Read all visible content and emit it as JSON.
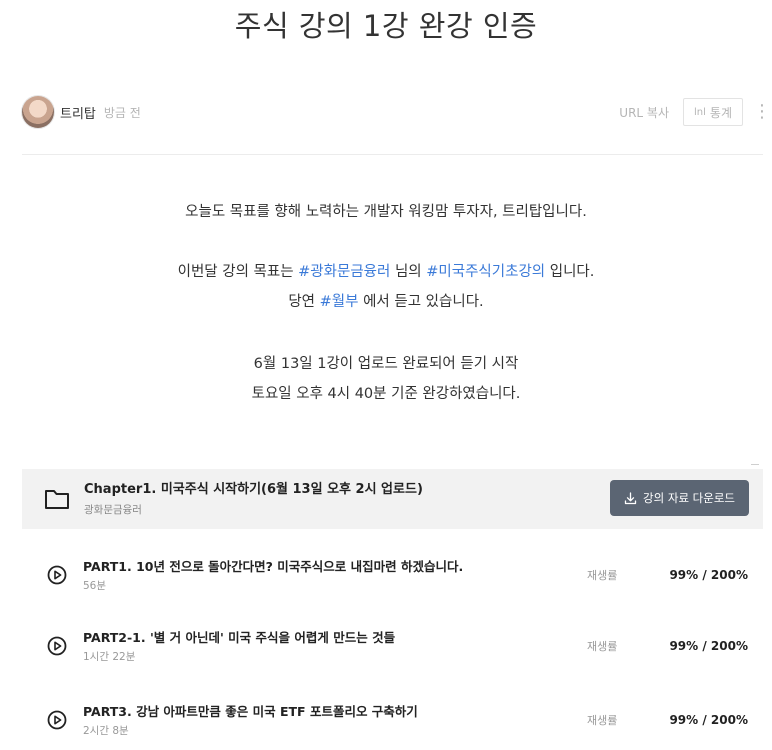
{
  "post": {
    "title": "주식 강의 1강 완강 인증",
    "author": "트리탑",
    "time": "방금 전",
    "url_copy": "URL 복사",
    "stats_label": "통계",
    "stats_icon": "lnl",
    "more_icon": "⋮"
  },
  "body": {
    "line1": "오늘도 목표를 향해 노력하는 개발자 워킹맘 투자자, 트리탑입니다.",
    "line2_pre": "이번달 강의 목표는 ",
    "line2_tag1": "#광화문금융러",
    "line2_mid": " 님의 ",
    "line2_tag2": "#미국주식기초강의",
    "line2_post": " 입니다.",
    "line3_pre": "당연 ",
    "line3_tag": "#월부",
    "line3_post": " 에서 듣고 있습니다.",
    "line4": "6월 13일 1강이 업로드 완료되어 듣기 시작",
    "line5": "토요일 오후 4시 40분 기준 완강하였습니다."
  },
  "chapter": {
    "title": "Chapter1. 미국주식 시작하기(6월 13일 오후 2시 업로드)",
    "instructor": "광화문금융러",
    "download_label": "강의 자료 다운로드"
  },
  "lessons": [
    {
      "title": "PART1. 10년 전으로 돌아간다면? 미국주식으로 내집마련 하겠습니다.",
      "duration": "56분",
      "label": "재생률",
      "value": "99% / 200%"
    },
    {
      "title": "PART2-1. '별 거 아닌데' 미국 주식을 어렵게 만드는 것들",
      "duration": "1시간 22분",
      "label": "재생률",
      "value": "99% / 200%"
    },
    {
      "title": "PART3. 강남 아파트만큼 좋은 미국 ETF 포트폴리오 구축하기",
      "duration": "2시간 8분",
      "label": "재생률",
      "value": "99% / 200%"
    }
  ],
  "colors": {
    "tag": "#3b7ad8",
    "download_bg": "#5b6573",
    "chapter_bg": "#f2f2f2"
  }
}
